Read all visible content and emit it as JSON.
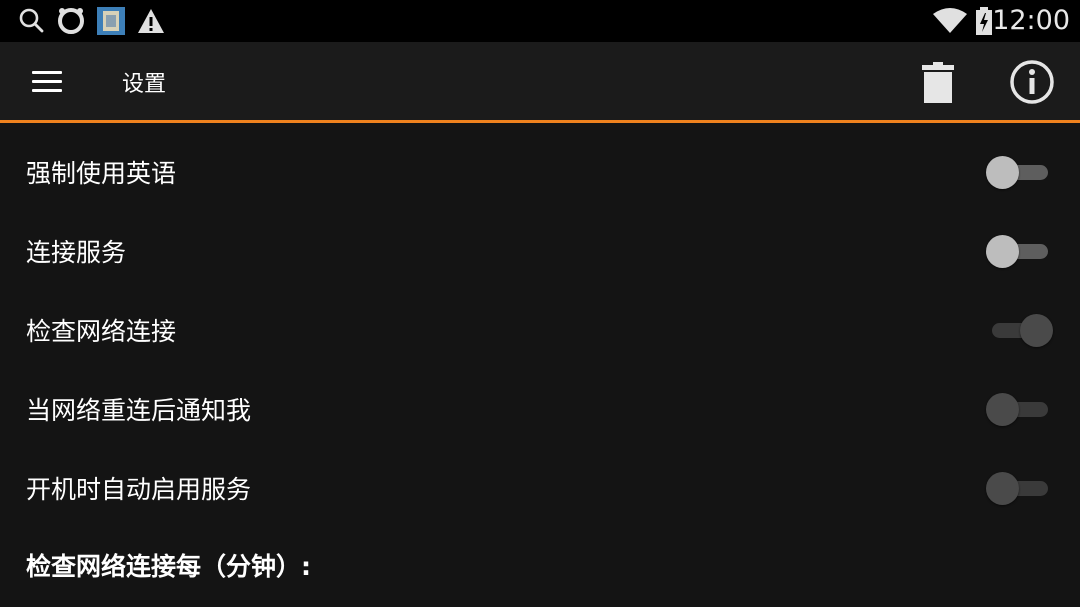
{
  "status_bar": {
    "time": "12:00",
    "left_icons": [
      "search-icon",
      "circle-logo-icon",
      "app-thumbnail-icon",
      "warning-icon"
    ],
    "right_icons": [
      "wifi-icon",
      "battery-charging-icon"
    ]
  },
  "app_bar": {
    "title": "设置",
    "actions": [
      "delete-icon",
      "info-icon"
    ],
    "accent_color": "#f0821e"
  },
  "settings": [
    {
      "label": "强制使用英语",
      "checked": false,
      "enabled": true
    },
    {
      "label": "连接服务",
      "checked": false,
      "enabled": true
    },
    {
      "label": "检查网络连接",
      "checked": true,
      "enabled": false
    },
    {
      "label": "当网络重连后通知我",
      "checked": false,
      "enabled": false
    },
    {
      "label": "开机时自动启用服务",
      "checked": false,
      "enabled": false
    }
  ],
  "section_header": "检查网络连接每（分钟）:"
}
